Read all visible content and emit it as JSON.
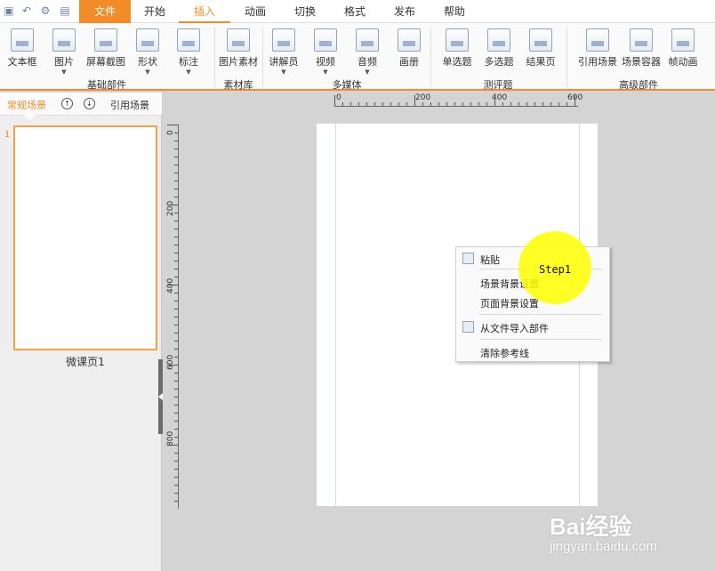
{
  "quick_access": [
    "save-icon",
    "undo-icon",
    "settings-icon",
    "preview-icon"
  ],
  "tabs": [
    {
      "label": "文件"
    },
    {
      "label": "开始"
    },
    {
      "label": "插入"
    },
    {
      "label": "动画"
    },
    {
      "label": "切换"
    },
    {
      "label": "格式"
    },
    {
      "label": "发布"
    },
    {
      "label": "帮助"
    }
  ],
  "ribbon": {
    "groups": [
      {
        "label": "基础部件"
      },
      {
        "label": "素材库"
      },
      {
        "label": "多媒体"
      },
      {
        "label": "测评题"
      },
      {
        "label": "高级部件"
      }
    ],
    "buttons": [
      {
        "label": "文本框"
      },
      {
        "label": "图片"
      },
      {
        "label": "屏幕截图"
      },
      {
        "label": "形状"
      },
      {
        "label": "标注"
      },
      {
        "label": "图片素材"
      },
      {
        "label": "讲解员"
      },
      {
        "label": "视频"
      },
      {
        "label": "音频"
      },
      {
        "label": "画册"
      },
      {
        "label": "单选题"
      },
      {
        "label": "多选题"
      },
      {
        "label": "结果页"
      },
      {
        "label": "引用场景"
      },
      {
        "label": "场景容器"
      },
      {
        "label": "帧动画"
      }
    ]
  },
  "left_panel": {
    "tab_label": "常规场景",
    "ref_label": "引用场景",
    "slide_number": "1",
    "slide_name": "微课页1"
  },
  "ruler": {
    "h_labels": [
      "0",
      "200",
      "400",
      "600"
    ],
    "v_labels": [
      "0",
      "200",
      "400",
      "600",
      "800"
    ]
  },
  "context_menu": {
    "items": [
      {
        "label": "粘贴"
      },
      {
        "label": "场景背景设置"
      },
      {
        "label": "页面背景设置"
      },
      {
        "label": "从文件导入部件"
      },
      {
        "label": "清除参考线"
      }
    ]
  },
  "annotation": {
    "step_label": "Step1",
    "color": "#ffff00"
  },
  "watermark": {
    "logo": "Bai经验",
    "url": "jingyan.baidu.com"
  },
  "colors": {
    "accent": "#f28c28",
    "file_tab_bg": "#f28c28",
    "canvas_bg": "#d4d4d4"
  }
}
